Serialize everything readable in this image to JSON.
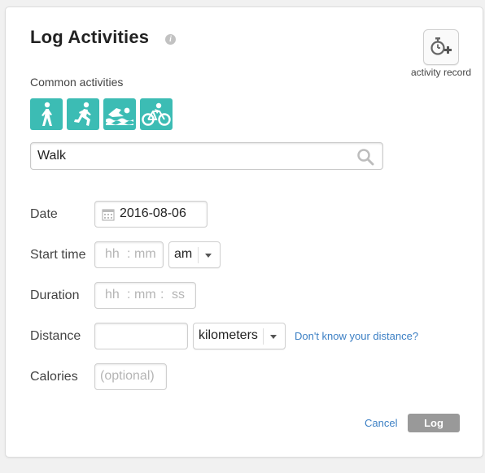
{
  "header": {
    "title": "Log Activities",
    "info_glyph": "i"
  },
  "activity_record": {
    "label": "activity record",
    "icon": "stopwatch-plus-icon"
  },
  "common_activities": {
    "label": "Common activities",
    "items": [
      {
        "icon": "walk-icon"
      },
      {
        "icon": "run-icon"
      },
      {
        "icon": "swim-icon"
      },
      {
        "icon": "bike-icon"
      }
    ],
    "accent_color": "#3cbcb4"
  },
  "search": {
    "value": "Walk",
    "icon": "search-icon"
  },
  "form": {
    "date": {
      "label": "Date",
      "value": "2016-08-06",
      "icon": "calendar-icon"
    },
    "start_time": {
      "label": "Start time",
      "hh": "hh",
      "sep": ":",
      "mm": "mm",
      "ampm": "am"
    },
    "duration": {
      "label": "Duration",
      "hh": "hh",
      "sep1": ":",
      "mm": "mm",
      "sep2": ":",
      "ss": "ss"
    },
    "distance": {
      "label": "Distance",
      "value": "",
      "unit": "kilometers",
      "help_link": "Don't know your distance?"
    },
    "calories": {
      "label": "Calories",
      "placeholder": "(optional)"
    }
  },
  "actions": {
    "cancel": "Cancel",
    "log": "Log"
  }
}
